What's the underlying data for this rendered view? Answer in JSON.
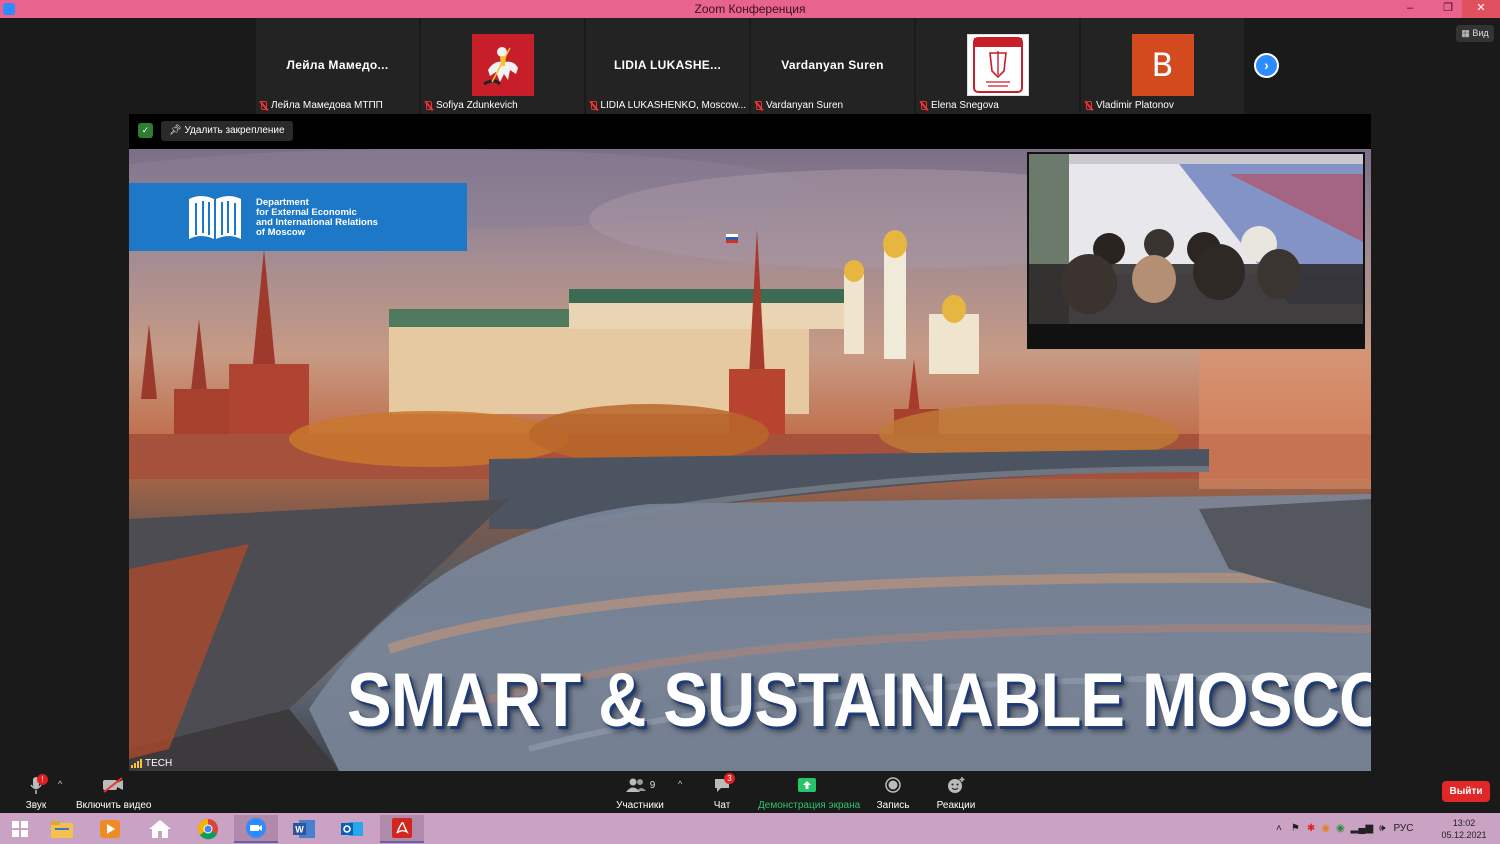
{
  "window": {
    "title": "Zoom Конференция",
    "minimize": "–",
    "maximize": "❐",
    "close": "✕"
  },
  "participants": [
    {
      "display": "Лейла  Мамедо...",
      "footer": "Лейла Мамедова МТПП",
      "avatar": "name"
    },
    {
      "display": "",
      "footer": "Sofiya Zdunkevich",
      "avatar": "moscow-coat-of-arms"
    },
    {
      "display": "LIDIA  LUKASHE...",
      "footer": "LIDIA LUKASHENKO, Moscow...",
      "avatar": "name"
    },
    {
      "display": "Vardanyan Suren",
      "footer": "Vardanyan Suren",
      "avatar": "name"
    },
    {
      "display": "",
      "footer": "Elena Snegova",
      "avatar": "chamber-of-commerce-logo"
    },
    {
      "display": "B",
      "footer": "Vladimir Platonov",
      "avatar": "letter"
    }
  ],
  "strip": {
    "next_icon": "›",
    "view_label": "Вид"
  },
  "pinned": {
    "unpin_label": "Удалить закрепление"
  },
  "share": {
    "department": [
      "Department",
      "for External Economic",
      "and International Relations",
      "of Moscow"
    ],
    "headline": "SMART & SUSTAINABLE MOSCOW",
    "connection_label": "TECH"
  },
  "toolbar": {
    "audio": "Звук",
    "video": "Включить видео",
    "participants": "Участники",
    "participants_count": "9",
    "chat": "Чат",
    "chat_badge": "3",
    "share": "Демонстрация экрана",
    "record": "Запись",
    "reactions": "Реакции",
    "leave": "Выйти",
    "audio_badge": "!"
  },
  "taskbar": {
    "lang": "РУС",
    "time": "13:02",
    "date": "05.12.2021"
  },
  "colors": {
    "title_bar": "#e8648c",
    "zoom_blue": "#2d8cff",
    "share_green": "#29c46a",
    "leave_red": "#e02828",
    "taskbar": "#c9a2c4"
  }
}
